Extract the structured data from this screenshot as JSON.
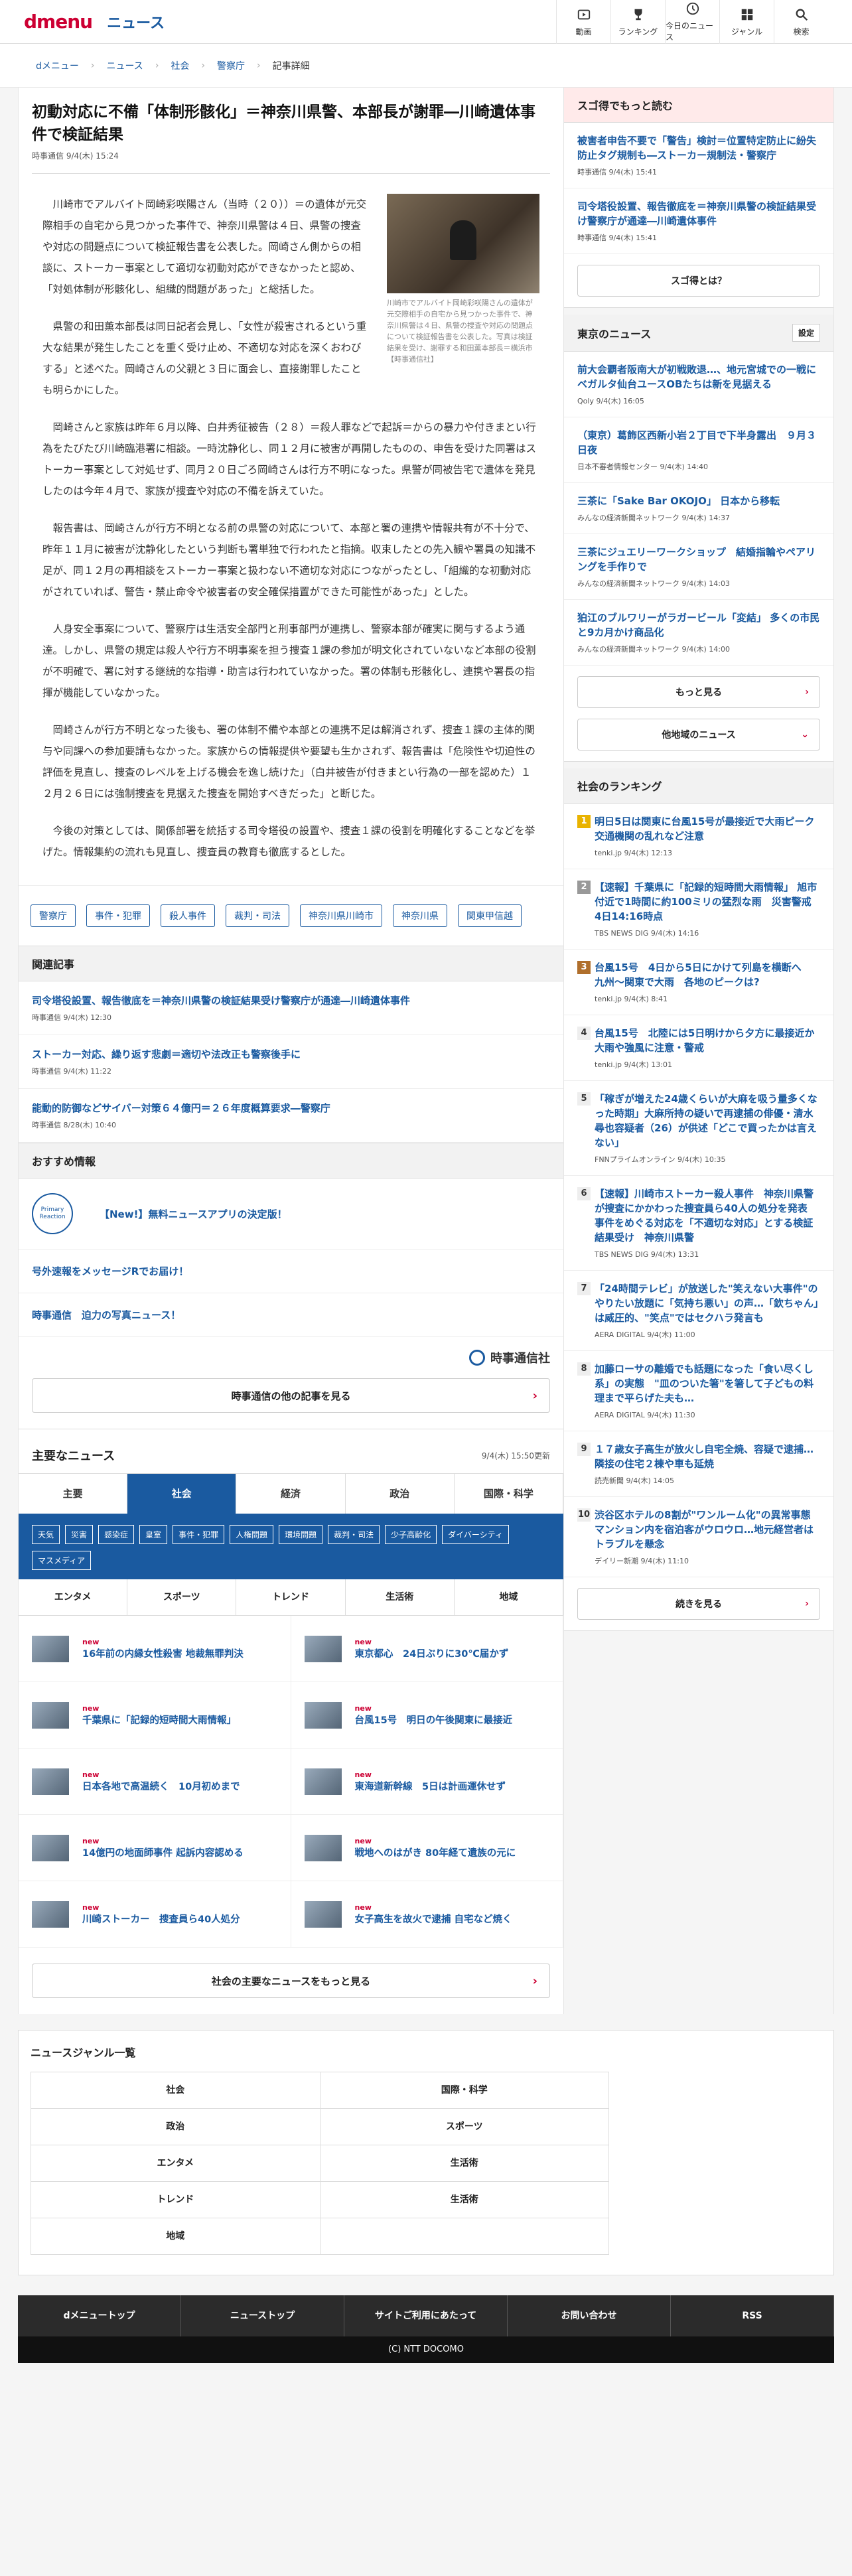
{
  "header": {
    "logo_d": "dmenu",
    "logo_news": "ニュース",
    "nav": [
      {
        "label": "動画",
        "icon": "video-icon"
      },
      {
        "label": "ランキング",
        "icon": "trophy-icon"
      },
      {
        "label": "今日のニュース",
        "icon": "clock-icon"
      },
      {
        "label": "ジャンル",
        "icon": "grid-icon"
      },
      {
        "label": "検索",
        "icon": "search-icon"
      }
    ]
  },
  "breadcrumb": [
    "dメニュー",
    "ニュース",
    "社会",
    "警察庁",
    "記事詳細"
  ],
  "article": {
    "title": "初動対応に不備「体制形骸化」＝神奈川県警、本部長が謝罪―川崎遺体事件で検証結果",
    "meta": "時事通信 9/4(木) 15:24",
    "caption": "川崎市でアルバイト岡崎彩咲陽さんの遺体が元交際相手の自宅から見つかった事件で、神奈川県警は４日、県警の捜査や対応の問題点について検証報告書を公表した。写真は検証結果を受け、謝罪する和田薫本部長＝横浜市【時事通信社】",
    "paragraphs": [
      "川崎市でアルバイト岡崎彩咲陽さん（当時（２０））＝の遺体が元交際相手の自宅から見つかった事件で、神奈川県警は４日、県警の捜査や対応の問題点について検証報告書を公表した。岡崎さん側からの相談に、ストーカー事案として適切な初動対応ができなかったと認め、「対処体制が形骸化し、組織的問題があった」と総括した。",
      "県警の和田薫本部長は同日記者会見し、「女性が殺害されるという重大な結果が発生したことを重く受け止め、不適切な対応を深くおわびする」と述べた。岡崎さんの父親と３日に面会し、直接謝罪したことも明らかにした。",
      "岡崎さんと家族は昨年６月以降、白井秀征被告（２８）＝殺人罪などで起訴＝からの暴力や付きまとい行為をたびたび川崎臨港署に相談。一時沈静化し、同１２月に被害が再開したものの、申告を受けた同署はストーカー事案として対処せず、同月２０日ごろ岡崎さんは行方不明になった。県警が同被告宅で遺体を発見したのは今年４月で、家族が捜査や対応の不備を訴えていた。",
      "報告書は、岡崎さんが行方不明となる前の県警の対応について、本部と署の連携や情報共有が不十分で、昨年１１月に被害が沈静化したという判断も署単独で行われたと指摘。収束したとの先入観や署員の知識不足が、同１２月の再相談をストーカー事案と扱わない不適切な対応につながったとし、「組織的な初動対応がされていれば、警告・禁止命令や被害者の安全確保措置ができた可能性があった」とした。",
      "人身安全事案について、警察庁は生活安全部門と刑事部門が連携し、警察本部が確実に関与するよう通達。しかし、県警の規定は殺人や行方不明事案を担う捜査１課の参加が明文化されていないなど本部の役割が不明確で、署に対する継続的な指導・助言は行われていなかった。署の体制も形骸化し、連携や署長の指揮が機能していなかった。",
      "岡崎さんが行方不明となった後も、署の体制不備や本部との連携不足は解消されず、捜査１課の主体的関与や同課への参加要請もなかった。家族からの情報提供や要望も生かされず、報告書は「危険性や切迫性の評価を見直し、捜査のレベルを上げる機会を逸し続けた」（白井被告が付きまとい行為の一部を認めた）１２月２６日には強制捜査を見据えた捜査を開始すべきだった」と断じた。",
      "今後の対策としては、関係部署を統括する司令塔役の設置や、捜査１課の役割を明確化することなどを挙げた。情報集約の流れも見直し、捜査員の教育も徹底するとした。"
    ],
    "tags": [
      "警察庁",
      "事件・犯罪",
      "殺人事件",
      "裁判・司法",
      "神奈川県川崎市",
      "神奈川県",
      "関東甲信越"
    ]
  },
  "related": {
    "heading": "関連記事",
    "items": [
      {
        "title": "司令塔役設置、報告徹底を＝神奈川県警の検証結果受け警察庁が通達―川崎遺体事件",
        "meta": "時事通信 9/4(木) 12:30"
      },
      {
        "title": "ストーカー対応、繰り返す悲劇＝適切や法改正も警察後手に",
        "meta": "時事通信 9/4(木) 11:22"
      },
      {
        "title": "能動的防御などサイバー対策６４億円＝２６年度概算要求―警察庁",
        "meta": "時事通信 8/28(木) 10:40"
      }
    ]
  },
  "recommend": {
    "heading": "おすすめ情報",
    "app_icon_text": "Primary Reaction",
    "items": [
      "【New!】無料ニュースアプリの決定版！",
      "号外速報をメッセージRでお届け！",
      "時事通信　迫力の写真ニュース！"
    ]
  },
  "jiji": {
    "logo": "時事通信社",
    "more_button": "時事通信の他の記事を見る"
  },
  "main_news": {
    "heading": "主要なニュース",
    "updated": "9/4(木) 15:50更新",
    "tabs": [
      "主要",
      "社会",
      "経済",
      "政治",
      "国際・科学"
    ],
    "active_tab": 1,
    "subtabs": [
      "天気",
      "災害",
      "感染症",
      "皇室",
      "事件・犯罪",
      "人権問題",
      "環境問題",
      "裁判・司法",
      "少子高齢化",
      "ダイバーシティ",
      "マスメディア"
    ],
    "tabs2": [
      "エンタメ",
      "スポーツ",
      "トレンド",
      "生活術",
      "地域"
    ],
    "new_label": "new",
    "items": [
      "16年前の内縁女性殺害 地裁無罪判決",
      "東京都心　24日ぶりに30℃届かず",
      "千葉県に「記録的短時間大雨情報」",
      "台風15号　明日の午後関東に最接近",
      "日本各地で高温続く　10月初めまで",
      "東海道新幹線　5日は計画運休せず",
      "14億円の地面師事件 起訴内容認める",
      "戦地へのはがき 80年経て遺族の元に",
      "川崎ストーカー　捜査員ら40人処分",
      "女子高生を故火で逮捕 自宅など焼く"
    ],
    "more_button": "社会の主要なニュースをもっと見る"
  },
  "genre": {
    "heading": "ニュースジャンル一覧",
    "items": [
      "社会",
      "国際・科学",
      "政治",
      "スポーツ",
      "エンタメ",
      "生活術",
      "トレンド",
      "地域",
      "地域",
      ""
    ]
  },
  "footer": {
    "links": [
      "dメニュートップ",
      "ニューストップ",
      "サイトご利用にあたって",
      "お問い合わせ",
      "RSS"
    ],
    "copyright": "(C) NTT DOCOMO"
  },
  "sidebar": {
    "sugotoku": {
      "heading": "スゴ得でもっと読む",
      "items": [
        {
          "title": "被害者申告不要で「警告」検討＝位置特定防止に紛失防止タグ規制も―ストーカー規制法・警察庁",
          "meta": "時事通信 9/4(木) 15:41"
        },
        {
          "title": "司令塔役設置、報告徹底を＝神奈川県警の検証結果受け警察庁が通達―川崎遺体事件",
          "meta": "時事通信 9/4(木) 15:41"
        }
      ],
      "button": "スゴ得とは？"
    },
    "tokyo": {
      "heading": "東京のニュース",
      "settings": "設定",
      "items": [
        {
          "title": "前大会覇者阪南大が初戦敗退…、地元宮城での一戦にベガルタ仙台ユースOBたちは新を見据える",
          "meta": "Qoly 9/4(木) 16:05"
        },
        {
          "title": "（東京）葛飾区西新小岩２丁目で下半身露出　９月３日夜",
          "meta": "日本不審者情報センター 9/4(木) 14:40"
        },
        {
          "title": "三茶に「Sake Bar OKOJO」 日本から移転",
          "meta": "みんなの経済新聞ネットワーク 9/4(木) 14:37"
        },
        {
          "title": "三茶にジュエリーワークショップ　結婚指輪やペアリングを手作りで",
          "meta": "みんなの経済新聞ネットワーク 9/4(木) 14:03"
        },
        {
          "title": "狛江のブルワリーがラガービール「変結」 多くの市民と9カ月かけ商品化",
          "meta": "みんなの経済新聞ネットワーク 9/4(木) 14:00"
        }
      ],
      "more": "もっと見る",
      "other": "他地域のニュース"
    },
    "ranking": {
      "heading": "社会のランキング",
      "items": [
        {
          "rank": "1",
          "title": "明日5日は関東に台風15号が最接近で大雨ピーク　交通機関の乱れなど注意",
          "meta": "tenki.jp 9/4(木) 12:13"
        },
        {
          "rank": "2",
          "title": "【速報】千葉県に「記録的短時間大雨情報」 旭市付近で1時間に約100ミリの猛烈な雨　災害警戒 4日14:16時点",
          "meta": "TBS NEWS DIG 9/4(木) 14:16"
        },
        {
          "rank": "3",
          "title": "台風15号　4日から5日にかけて列島を横断へ　九州〜関東で大雨　各地のピークは?",
          "meta": "tenki.jp 9/4(木) 8:41"
        },
        {
          "rank": "4",
          "title": "台風15号　北陸には5日明けから夕方に最接近か　大雨や強風に注意・警戒",
          "meta": "tenki.jp 9/4(木) 13:01"
        },
        {
          "rank": "5",
          "title": "「稼ぎが増えた24歳くらいが大麻を吸う量多くなった時期」大麻所持の疑いで再逮捕の俳優・清水尋也容疑者（26）が供述「どこで買ったかは言えない」",
          "meta": "FNNプライムオンライン 9/4(木) 10:35"
        },
        {
          "rank": "6",
          "title": "【速報】川崎市ストーカー殺人事件　神奈川県警が捜査にかかわった捜査員ら40人の処分を発表　事件をめぐる対応を「不適切な対応」とする検証結果受け　神奈川県警",
          "meta": "TBS NEWS DIG 9/4(木) 13:31"
        },
        {
          "rank": "7",
          "title": "「24時間テレビ」が放送した\"笑えない大事件\"のやりたい放題に「気持ち悪い」の声…「欽ちゃん」は威圧的、\"笑点\"ではセクハラ発言も",
          "meta": "AERA DIGITAL 9/4(木) 11:00"
        },
        {
          "rank": "8",
          "title": "加藤ローサの離婚でも話題になった「食い尽くし系」の実態　\"皿のついた箸\"を箸して子どもの料理まで平らげた夫も…",
          "meta": "AERA DIGITAL 9/4(木) 11:30"
        },
        {
          "rank": "9",
          "title": "１７歳女子高生が放火し自宅全焼、容疑で逮捕…隣接の住宅２棟や車も延焼",
          "meta": "読売新聞 9/4(木) 14:05"
        },
        {
          "rank": "10",
          "title": "渋谷区ホテルの8割が\"ワンルーム化\"の異常事態　マンション内を宿泊客がウロウロ…地元経営者はトラブルを懸念",
          "meta": "デイリー新潮 9/4(木) 11:10"
        }
      ],
      "more": "続きを見る"
    }
  }
}
